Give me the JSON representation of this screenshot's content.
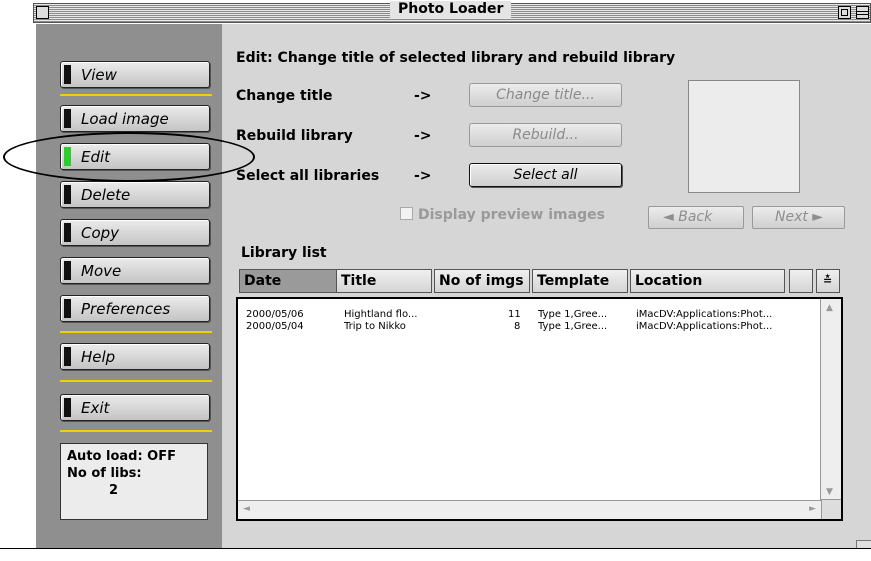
{
  "window": {
    "title": "Photo Loader"
  },
  "sidebar": {
    "buttons": [
      {
        "label": "View"
      },
      {
        "label": "Load image"
      },
      {
        "label": "Edit"
      },
      {
        "label": "Delete"
      },
      {
        "label": "Copy"
      },
      {
        "label": "Move"
      },
      {
        "label": "Preferences"
      },
      {
        "label": "Help"
      },
      {
        "label": "Exit"
      }
    ],
    "status": {
      "auto_load": "Auto load: OFF",
      "libs_label": "No of libs:",
      "libs_count": "2"
    }
  },
  "main": {
    "heading": "Edit: Change title of selected library and rebuild library",
    "rows": [
      {
        "label": "Change title",
        "arrow": "->",
        "button": "Change title..."
      },
      {
        "label": "Rebuild library",
        "arrow": "->",
        "button": "Rebuild..."
      },
      {
        "label": "Select all libraries",
        "arrow": "->",
        "button": "Select all"
      }
    ],
    "preview_checkbox": "Display preview images",
    "back": "◄ Back",
    "next": "Next ►"
  },
  "library": {
    "label": "Library list",
    "columns": [
      "Date",
      "Title",
      "No of imgs",
      "Template",
      "Location"
    ],
    "rows": [
      {
        "date": "2000/05/06",
        "title": "Hightland flo...",
        "imgs": "11",
        "template": "Type 1,Gree...",
        "location": "iMacDV:Applications:Phot..."
      },
      {
        "date": "2000/05/04",
        "title": "Trip to Nikko",
        "imgs": "8",
        "template": "Type 1,Gree...",
        "location": "iMacDV:Applications:Phot..."
      }
    ]
  },
  "colors": {
    "selected_flag": "#2fcc2f",
    "separator": "#f0d000",
    "sidebar_bg": "#8f8f8f"
  }
}
